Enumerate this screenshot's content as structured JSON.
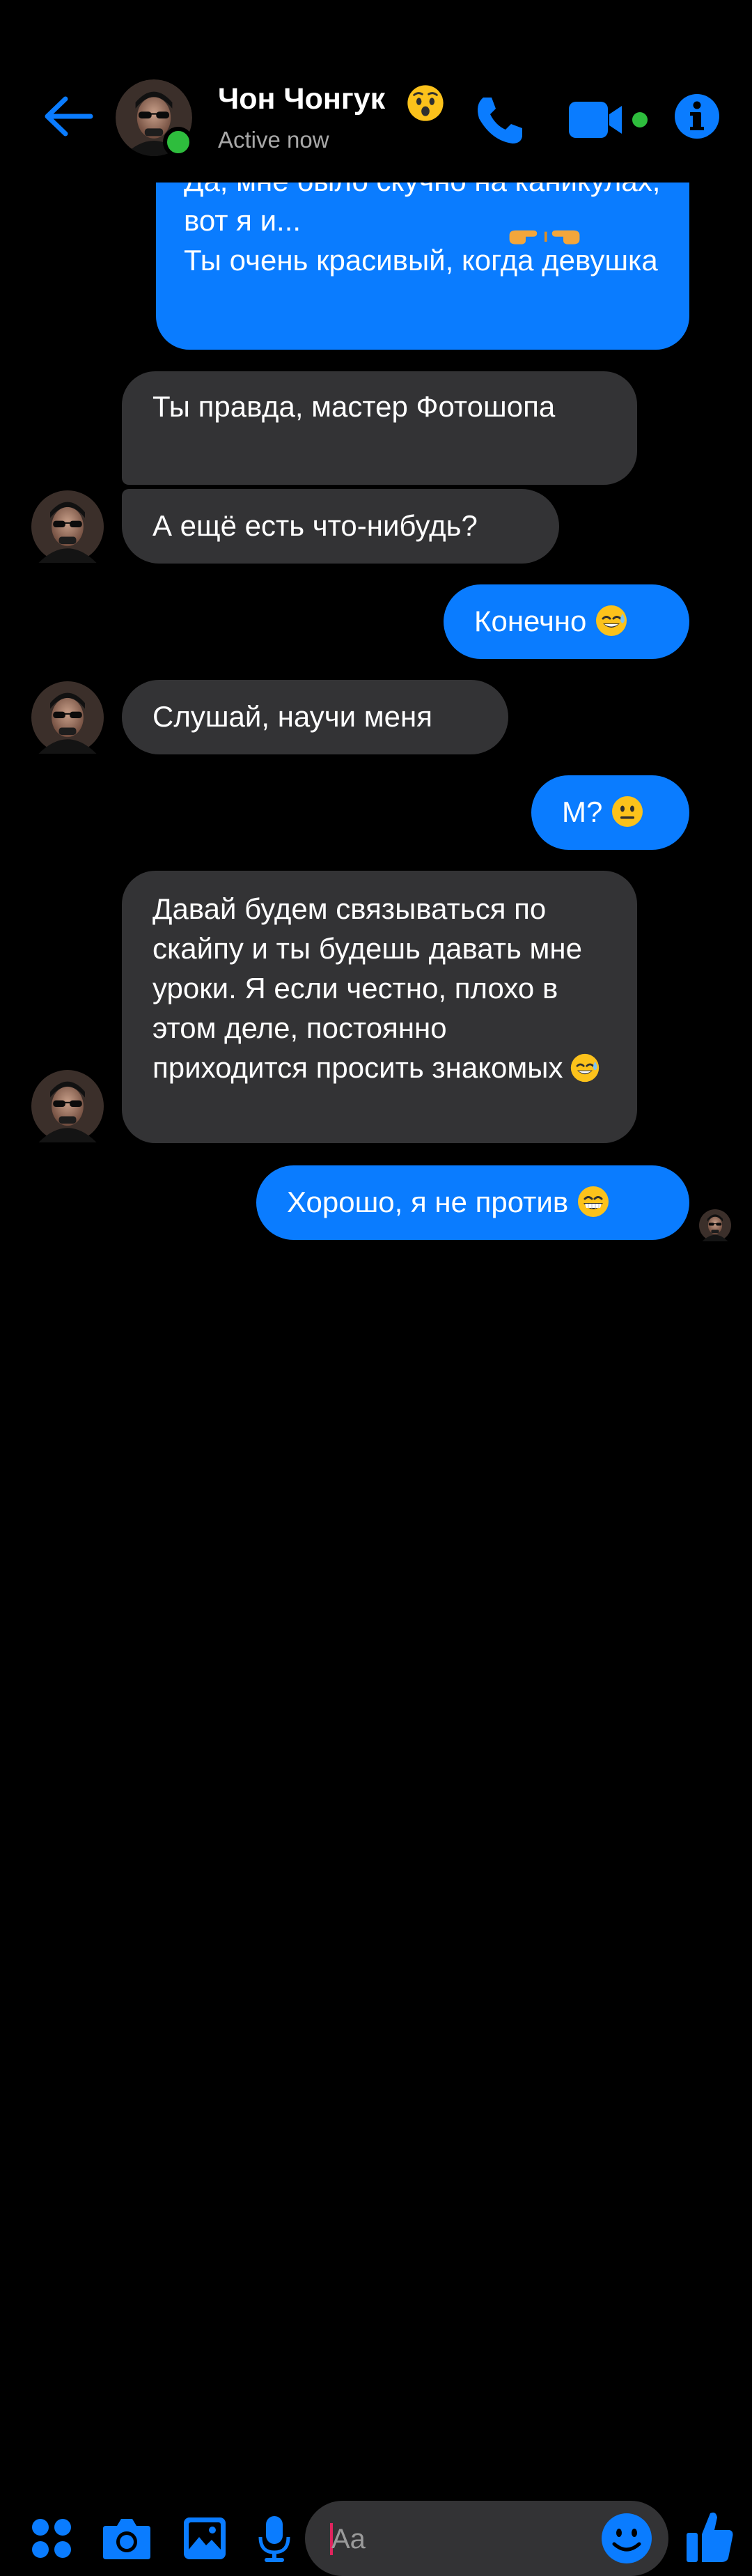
{
  "header": {
    "contact_name": "Чон Чонгук",
    "status": "Active now"
  },
  "messages": [
    {
      "direction": "out",
      "text": "Да, мне было скучно на каникулах, вот я и...\nТы очень красивый, когда девушка",
      "emoji": "pointing-hands"
    },
    {
      "direction": "in",
      "text": "Ты правда, мастер Фотошопа"
    },
    {
      "direction": "in",
      "text": "А ещё есть что-нибудь?"
    },
    {
      "direction": "out",
      "text": "Конечно",
      "emoji": "sweat-smile"
    },
    {
      "direction": "in",
      "text": "Слушай, научи меня"
    },
    {
      "direction": "out",
      "text": "М?",
      "emoji": "neutral-face"
    },
    {
      "direction": "in",
      "text": "Давай будем связываться по скайпу и ты будешь давать мне уроки. Я если честно, плохо в этом деле, постоянно приходится просить знакомых",
      "emoji": "sweat-smile"
    },
    {
      "direction": "out",
      "text": "Хорошо, я не против",
      "emoji": "grinning-face"
    }
  ],
  "composer": {
    "placeholder": "Aa"
  },
  "colors": {
    "background": "#000000",
    "accent": "#0a7cff",
    "incoming_bubble": "#333335",
    "online": "#2ebd3d"
  }
}
